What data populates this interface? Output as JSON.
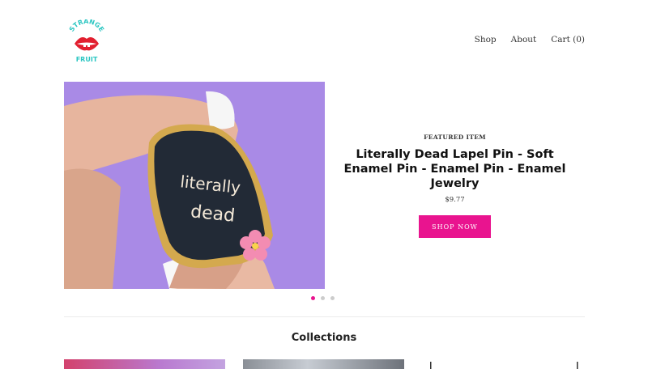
{
  "brand": {
    "logo_text_top": "STRANGE",
    "logo_text_bottom": "FRUIT"
  },
  "nav": {
    "shop": "Shop",
    "about": "About",
    "cart": "Cart (0)"
  },
  "featured": {
    "eyebrow": "FEATURED ITEM",
    "title": "Literally Dead Lapel Pin - Soft Enamel Pin - Enamel Pin - Enamel Jewelry",
    "price": "$9.77",
    "button": "SHOP NOW",
    "pin_text_line1": "literally",
    "pin_text_line2": "dead"
  },
  "slider": {
    "slide_count": 3,
    "active_index": 0
  },
  "collections": {
    "title": "Collections"
  },
  "colors": {
    "accent": "#e9148f",
    "slide_bg": "#a98ae6"
  }
}
